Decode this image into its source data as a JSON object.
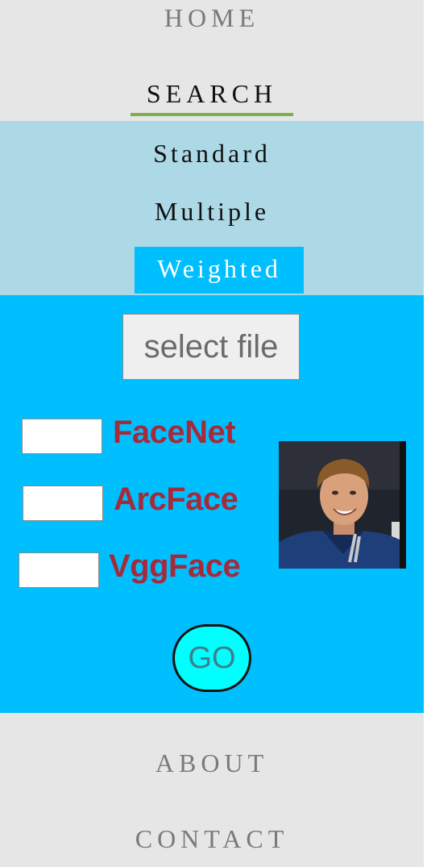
{
  "nav": {
    "home": "HOME",
    "search": "SEARCH",
    "about": "ABOUT",
    "contact": "CONTACT"
  },
  "search_menu": {
    "standard": "Standard",
    "multiple": "Multiple",
    "weighted": "Weighted"
  },
  "form": {
    "file_button": "select file",
    "models": [
      {
        "label": "FaceNet",
        "value": ""
      },
      {
        "label": "ArcFace",
        "value": ""
      },
      {
        "label": "VggFace",
        "value": ""
      }
    ],
    "go_button": "GO"
  },
  "colors": {
    "nav_bg": "#e6e6e6",
    "submenu_bg": "#add8e6",
    "main_bg": "#00bfff",
    "active_underline": "#7db046",
    "model_label": "#a52a3a",
    "go_bg": "#00ffff"
  }
}
